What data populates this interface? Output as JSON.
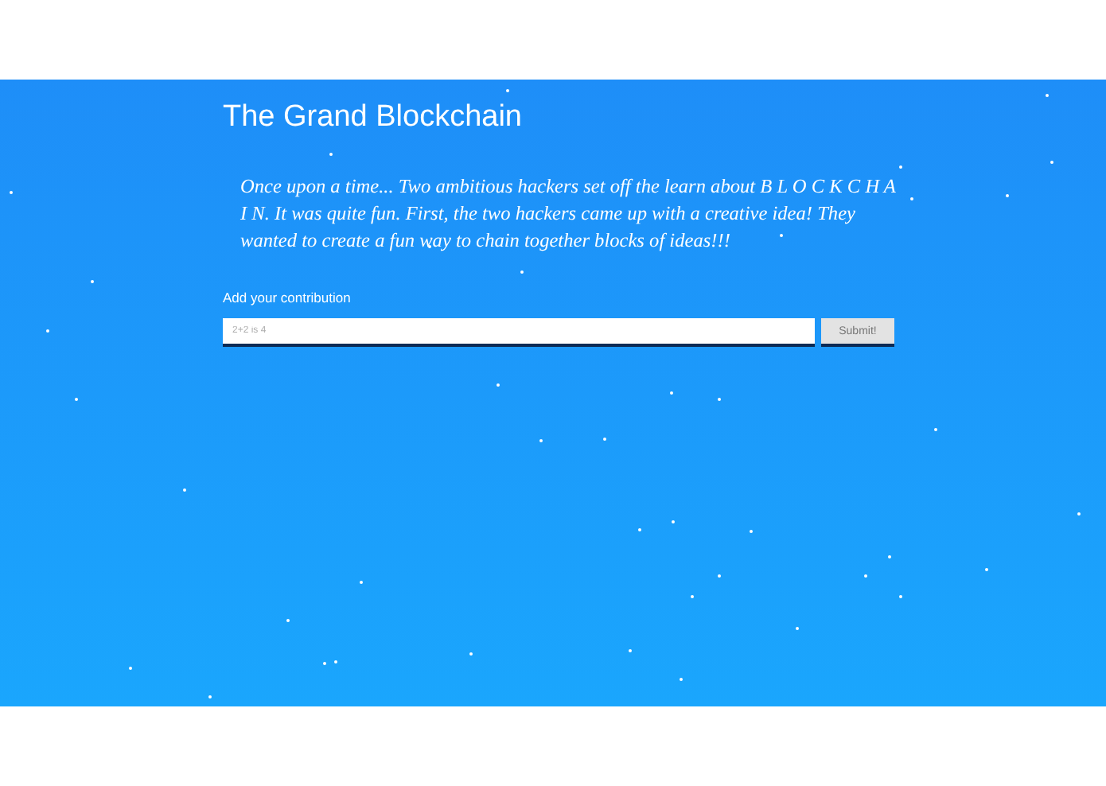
{
  "header": {
    "title": "The Grand Blockchain"
  },
  "story": "Once upon a time... Two ambitious hackers set off the learn about B L O C K C H A I N. It was quite fun. First, the two hackers came up with a creative idea! They wanted to create a fun way to chain together blocks of ideas!!!",
  "contribution_form": {
    "label": "Add your contribution",
    "placeholder": "2+2 is 4",
    "button": "Submit!"
  }
}
